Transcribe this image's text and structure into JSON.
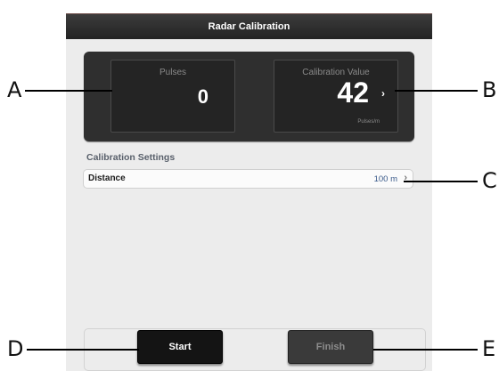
{
  "window": {
    "title": "Radar Calibration"
  },
  "readouts": {
    "pulses": {
      "label": "Pulses",
      "value": "0"
    },
    "calibration": {
      "label": "Calibration Value",
      "value": "42",
      "unit": "Pulses/m"
    }
  },
  "settings": {
    "header": "Calibration Settings",
    "rows": [
      {
        "label": "Distance",
        "value": "100 m"
      }
    ]
  },
  "buttons": {
    "start": "Start",
    "finish": "Finish"
  },
  "callouts": {
    "a": "A",
    "b": "B",
    "c": "C",
    "d": "D",
    "e": "E"
  },
  "icons": {
    "chevron": "chevron-right-icon"
  }
}
